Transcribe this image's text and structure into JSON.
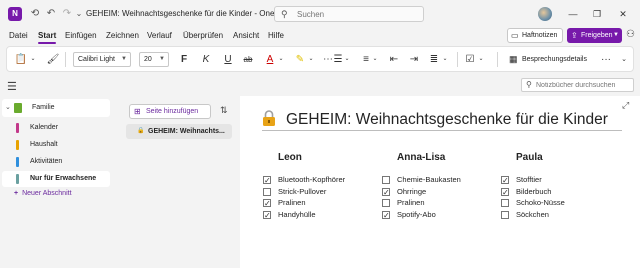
{
  "titlebar": {
    "app_icon": "N",
    "doc_title": "GEHEIM: Weihnachtsgeschenke für die Kinder  -  One...",
    "search_placeholder": "Suchen"
  },
  "menu": {
    "items": [
      "Datei",
      "Start",
      "Einfügen",
      "Zeichnen",
      "Verlauf",
      "Überprüfen",
      "Ansicht",
      "Hilfe"
    ],
    "active": "Start",
    "haftnotizen": "Haftnotizen",
    "freigeben": "Freigeben"
  },
  "ribbon": {
    "font_name": "Calibri Light",
    "font_size": "20",
    "bold": "F",
    "italic": "K",
    "underline": "U",
    "strike": "ab",
    "besprechung": "Besprechungsdetails",
    "more": "···"
  },
  "search": {
    "placeholder": "Notizbücher durchsuchen"
  },
  "notebook": {
    "name": "Familie",
    "sections": [
      {
        "label": "Kalender",
        "color": "#c2388a"
      },
      {
        "label": "Haushalt",
        "color": "#e8a200"
      },
      {
        "label": "Aktivitäten",
        "color": "#2f8fdd"
      },
      {
        "label": "Nur für Erwachsene",
        "color": "#6aa0a0",
        "active": true
      }
    ],
    "new_section": "Neuer Abschnitt"
  },
  "pages": {
    "add_label": "Seite hinzufügen",
    "items": [
      "GEHEIM: Weihnachts..."
    ]
  },
  "page": {
    "title": "GEHEIM: Weihnachtsgeschenke für die Kinder",
    "columns": [
      {
        "name": "Leon",
        "items": [
          {
            "text": "Bluetooth-Kopfhörer",
            "checked": true
          },
          {
            "text": "Strick-Pullover",
            "checked": false
          },
          {
            "text": "Pralinen",
            "checked": true
          },
          {
            "text": "Handyhülle",
            "checked": true
          }
        ]
      },
      {
        "name": "Anna-Lisa",
        "items": [
          {
            "text": "Chemie-Baukasten",
            "checked": false
          },
          {
            "text": "Ohrringe",
            "checked": true
          },
          {
            "text": "Pralinen",
            "checked": false
          },
          {
            "text": "Spotify-Abo",
            "checked": true
          }
        ]
      },
      {
        "name": "Paula",
        "items": [
          {
            "text": "Stofftier",
            "checked": true
          },
          {
            "text": "Bilderbuch",
            "checked": true
          },
          {
            "text": "Schoko-Nüsse",
            "checked": false
          },
          {
            "text": "Söckchen",
            "checked": false
          }
        ]
      }
    ]
  }
}
